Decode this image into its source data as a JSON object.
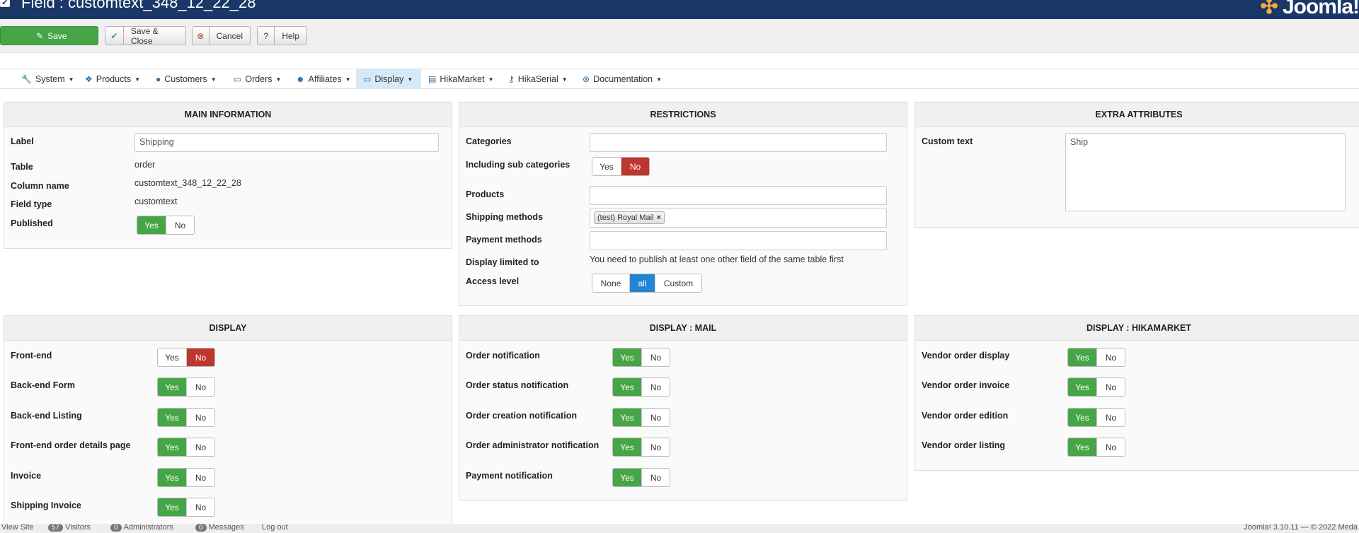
{
  "header": {
    "title": "Field : customtext_348_12_22_28",
    "logo_text": "Joomla!"
  },
  "toolbar": {
    "save": "Save",
    "save_close": "Save & Close",
    "cancel": "Cancel",
    "help": "Help"
  },
  "menu": [
    "System",
    "Products",
    "Customers",
    "Orders",
    "Affiliates",
    "Display",
    "HikaMarket",
    "HikaSerial",
    "Documentation"
  ],
  "main_info": {
    "heading": "MAIN INFORMATION",
    "label_label": "Label",
    "label_value": "Shipping",
    "table_label": "Table",
    "table_value": "order",
    "column_label": "Column name",
    "column_value": "customtext_348_12_22_28",
    "type_label": "Field type",
    "type_value": "customtext",
    "published_label": "Published"
  },
  "restrictions": {
    "heading": "RESTRICTIONS",
    "categories": "Categories",
    "sub_categories": "Including sub categories",
    "products": "Products",
    "shipping": "Shipping methods",
    "shipping_tag": "(test) Royal Mail",
    "payment": "Payment methods",
    "display_limited": "Display limited to",
    "display_limited_value": "You need to publish at least one other field of the same table first",
    "access": "Access level",
    "access_none": "None",
    "access_all": "all",
    "access_custom": "Custom"
  },
  "extra": {
    "heading": "EXTRA ATTRIBUTES",
    "custom_text_label": "Custom text",
    "custom_text_value": "Ship"
  },
  "display": {
    "heading": "DISPLAY",
    "rows": [
      "Front-end",
      "Back-end Form",
      "Back-end Listing",
      "Front-end order details page",
      "Invoice",
      "Shipping Invoice"
    ]
  },
  "display_mail": {
    "heading": "DISPLAY : MAIL",
    "rows": [
      "Order notification",
      "Order status notification",
      "Order creation notification",
      "Order administrator notification",
      "Payment notification"
    ]
  },
  "display_hika": {
    "heading": "DISPLAY : HIKAMARKET",
    "rows": [
      "Vendor order display",
      "Vendor order invoice",
      "Vendor order edition",
      "Vendor order listing"
    ]
  },
  "toggle": {
    "yes": "Yes",
    "no": "No"
  },
  "status": {
    "view_site": "View Site",
    "visitors_count": "57",
    "visitors": "Visitors",
    "admins_count": "0",
    "admins": "Administrators",
    "messages_count": "0",
    "messages": "Messages",
    "logout": "Log out",
    "version": "Joomla! 3.10.11 — © 2022 Meda"
  }
}
